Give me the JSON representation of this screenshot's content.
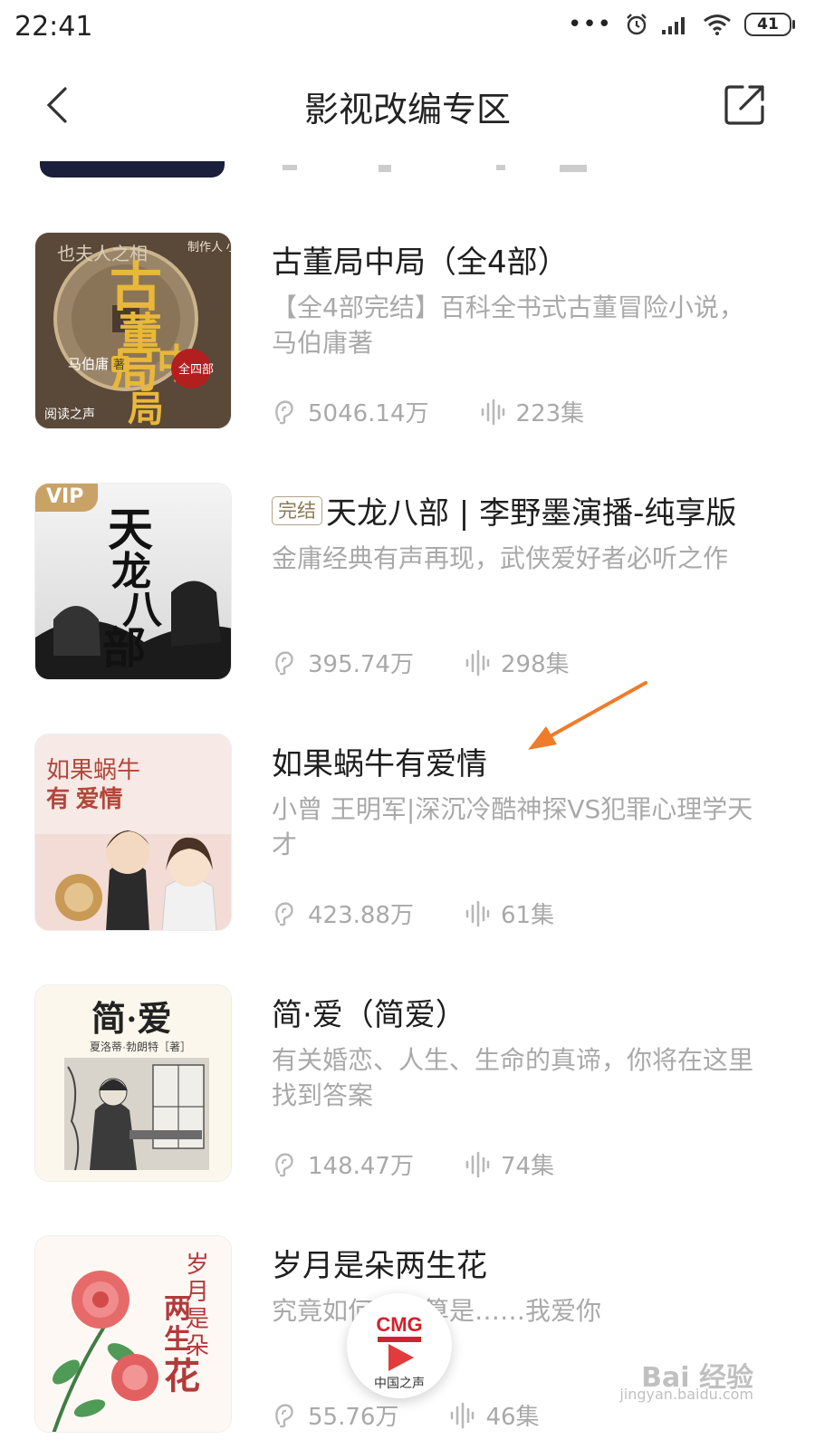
{
  "status_bar": {
    "time": "22:41",
    "dots": "•••",
    "battery": "41"
  },
  "header": {
    "title": "影视改编专区"
  },
  "items": [
    {
      "title": "古董局中局（全4部）",
      "tag": "",
      "desc": "【全4部完结】百科全书式古董冒险小说，马伯庸著",
      "plays": "5046.14万",
      "episodes": "223集",
      "cover": {
        "top_words": "也夫人之相",
        "title_chars": [
          "古",
          "董",
          "局",
          "中",
          "局"
        ],
        "producer": "制作人 小曾",
        "author": "马伯庸",
        "author_mark": "著",
        "seal": "全四部",
        "brand": "阅读之声"
      }
    },
    {
      "title": "天龙八部 | 李野墨演播-纯享版",
      "tag": "完结",
      "desc": "金庸经典有声再现，武侠爱好者必听之作",
      "plays": "395.74万",
      "episodes": "298集",
      "cover": {
        "vip": "VIP",
        "title_chars": [
          "天",
          "龙",
          "八",
          "部"
        ]
      }
    },
    {
      "title": "如果蜗牛有爱情",
      "tag": "",
      "desc": "小曾 王明军|深沉冷酷神探VS犯罪心理学天才",
      "plays": "423.88万",
      "episodes": "61集",
      "cover": {
        "line1": "如果蜗牛",
        "line2": "有  爱情"
      }
    },
    {
      "title": "简·爱（简爱）",
      "tag": "",
      "desc": "有关婚恋、人生、生命的真谛，你将在这里找到答案",
      "plays": "148.47万",
      "episodes": "74集",
      "cover": {
        "title": "简·爱",
        "author": "夏洛蒂·勃朗特［著］"
      }
    },
    {
      "title": "岁月是朵两生花",
      "tag": "",
      "desc": "究竟如何才能算是……我爱你",
      "plays": "55.76万",
      "episodes": "46集",
      "cover": {
        "title_chars": [
          "岁",
          "月",
          "是",
          "朵"
        ],
        "title_chars2": [
          "两",
          "生",
          "花"
        ]
      }
    }
  ],
  "player": {
    "logo": "CMG",
    "name": "中国之声"
  },
  "watermark": {
    "logo": "Bai 经验",
    "url": "jingyan.baidu.com"
  },
  "colors": {
    "accent_arrow": "#f07b2a",
    "text_muted": "#a9a9a9"
  }
}
